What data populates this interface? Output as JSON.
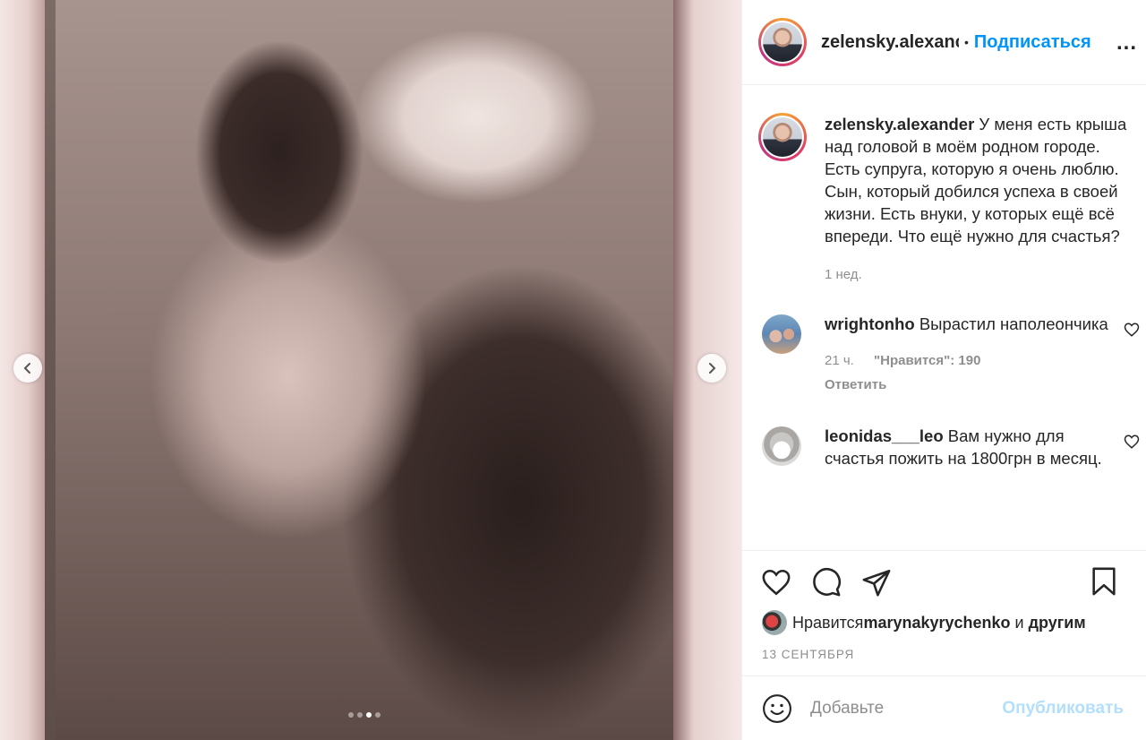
{
  "post": {
    "image_alt": "",
    "carousel": {
      "slides": 4,
      "active": 3
    }
  },
  "header": {
    "username": "zelensky.alexanc",
    "separator": "•",
    "follow_label": "Подписаться",
    "more_label": "..."
  },
  "caption": {
    "username": "zelensky.alexander",
    "text": " У меня есть крыша над головой в моём родном городе. Есть супруга, которую я очень люблю. Сын, который добился успеха в своей жизни. Есть внуки, у которых ещё всё впереди. Что ещё нужно для счастья?",
    "time": "1 нед."
  },
  "comments": [
    {
      "username": "wrightonho",
      "text": " Вырастил наполеончика",
      "time": "21 ч.",
      "likes": "\"Нравится\": 190",
      "reply_label": "Ответить"
    },
    {
      "username": "leonidas___leo",
      "text": " Вам нужно для счастья пожить на 1800грн в месяц."
    }
  ],
  "likes_line": {
    "prefix": "Нравится ",
    "user": "marynakyrychenko",
    "middle": " и ",
    "others": "другим"
  },
  "date": "13 сентября",
  "add_comment": {
    "placeholder": "Добавьте",
    "publish_label": "Опубликовать"
  },
  "colors": {
    "accent": "#0095f6",
    "muted": "#8e8e8e",
    "publish_disabled": "#b2dffc"
  },
  "icons": [
    "chevron-left-icon",
    "chevron-right-icon",
    "more-icon",
    "heart-icon",
    "comment-icon",
    "share-icon",
    "bookmark-icon",
    "emoji-icon"
  ]
}
